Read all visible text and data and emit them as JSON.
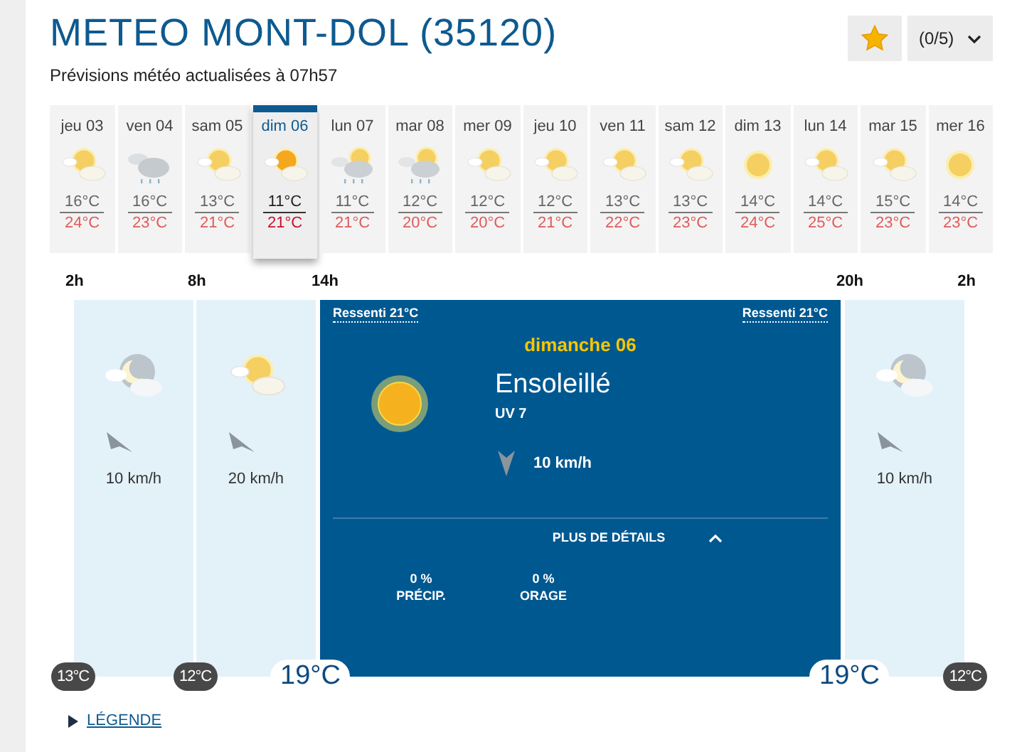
{
  "header": {
    "title": "METEO MONT-DOL (35120)",
    "subtitle": "Prévisions météo actualisées à 07h57"
  },
  "rating": {
    "score": "(0/5)"
  },
  "days": [
    {
      "label": "jeu 03",
      "kind": "sun-cloud",
      "low": "16°C",
      "high": "24°C",
      "selected": false
    },
    {
      "label": "ven 04",
      "kind": "cloud-rain",
      "low": "16°C",
      "high": "23°C",
      "selected": false
    },
    {
      "label": "sam 05",
      "kind": "sun-cloud",
      "low": "13°C",
      "high": "21°C",
      "selected": false
    },
    {
      "label": "dim 06",
      "kind": "sun-cloud",
      "low": "11°C",
      "high": "21°C",
      "selected": true
    },
    {
      "label": "lun 07",
      "kind": "sun-cloud-rain",
      "low": "11°C",
      "high": "21°C",
      "selected": false
    },
    {
      "label": "mar 08",
      "kind": "sun-cloud-rain",
      "low": "12°C",
      "high": "20°C",
      "selected": false
    },
    {
      "label": "mer 09",
      "kind": "sun-cloud",
      "low": "12°C",
      "high": "20°C",
      "selected": false
    },
    {
      "label": "jeu 10",
      "kind": "sun-cloud",
      "low": "12°C",
      "high": "21°C",
      "selected": false
    },
    {
      "label": "ven 11",
      "kind": "sun-cloud",
      "low": "13°C",
      "high": "22°C",
      "selected": false
    },
    {
      "label": "sam 12",
      "kind": "sun-cloud",
      "low": "13°C",
      "high": "23°C",
      "selected": false
    },
    {
      "label": "dim 13",
      "kind": "sun",
      "low": "14°C",
      "high": "24°C",
      "selected": false
    },
    {
      "label": "lun 14",
      "kind": "sun-cloud",
      "low": "14°C",
      "high": "25°C",
      "selected": false
    },
    {
      "label": "mar 15",
      "kind": "sun-cloud",
      "low": "15°C",
      "high": "23°C",
      "selected": false
    },
    {
      "label": "mer 16",
      "kind": "sun",
      "low": "14°C",
      "high": "23°C",
      "selected": false
    }
  ],
  "timeline": {
    "ticks": [
      {
        "hour": "2h",
        "temp": "13°C",
        "kind": "small"
      },
      {
        "hour": "8h",
        "temp": "12°C",
        "kind": "small"
      },
      {
        "hour": "14h",
        "temp": "19°C",
        "kind": "large"
      },
      {
        "hour": "20h",
        "temp": "19°C",
        "kind": "large"
      },
      {
        "hour": "2h",
        "temp": "12°C",
        "kind": "small"
      }
    ],
    "slots": [
      {
        "kind": "night",
        "wind": "10 km/h"
      },
      {
        "kind": "sun-cloud",
        "wind": "20 km/h"
      },
      {
        "kind": "detail",
        "feels_like_left": "Ressenti 21°C",
        "feels_like_right": "Ressenti 21°C",
        "day": "dimanche 06",
        "condition": "Ensoleillé",
        "uv": "UV 7",
        "wind": "10 km/h",
        "details_toggle": {
          "label": "PLUS DE DÉTAILS",
          "expanded": true
        },
        "stats": [
          {
            "value": "0 %",
            "label": "PRÉCIP."
          },
          {
            "value": "0 %",
            "label": "ORAGE"
          }
        ]
      },
      {
        "kind": "night",
        "wind": "10 km/h"
      }
    ]
  },
  "legend": {
    "label": "LÉGENDE"
  }
}
